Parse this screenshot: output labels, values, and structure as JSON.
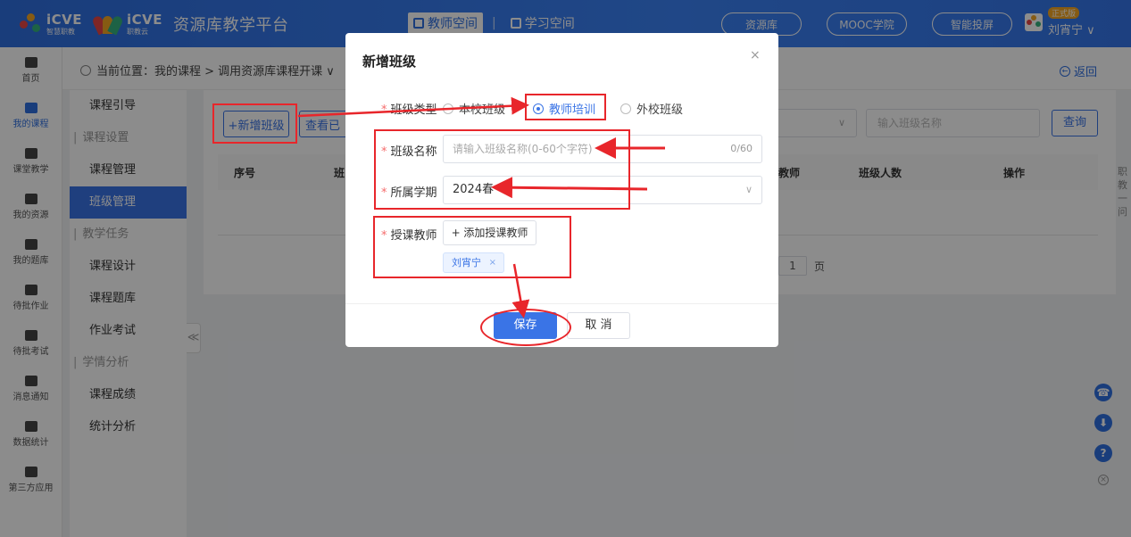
{
  "header": {
    "logo1_big": "iCVE",
    "logo1_small": "智慧职教",
    "logo2_big": "iCVE",
    "logo2_small": "职教云",
    "platform_title": "资源库教学平台",
    "tab_teacher": "教师空间",
    "tab_separator": "|",
    "tab_student": "学习空间",
    "btn_resource": "资源库",
    "btn_mooc": "MOOC学院",
    "btn_screen": "智能投屏",
    "vip_badge": "正式版",
    "user_name": "刘宵宁 ∨"
  },
  "iconnav": [
    {
      "label": "首页",
      "active": false
    },
    {
      "label": "我的课程",
      "active": true
    },
    {
      "label": "课堂教学",
      "active": false
    },
    {
      "label": "我的资源",
      "active": false
    },
    {
      "label": "我的题库",
      "active": false
    },
    {
      "label": "待批作业",
      "active": false
    },
    {
      "label": "待批考试",
      "active": false
    },
    {
      "label": "消息通知",
      "active": false
    },
    {
      "label": "数据统计",
      "active": false
    },
    {
      "label": "第三方应用",
      "active": false
    }
  ],
  "breadcrumb": {
    "text": "当前位置：我的课程 > 调用资源库课程开课 ∨",
    "back": "返回"
  },
  "submenu": {
    "item_guide": "课程引导",
    "group_setting": "课程设置",
    "item_course_mgmt": "课程管理",
    "item_class_mgmt": "班级管理",
    "group_task": "教学任务",
    "item_design": "课程设计",
    "item_bank": "课程题库",
    "item_exam": "作业考试",
    "group_analysis": "学情分析",
    "item_score": "课程成绩",
    "item_stats": "统计分析",
    "collapse": "≪"
  },
  "main": {
    "btn_new": "+新增班级",
    "btn_view": "查看已",
    "search_placeholder": "输入班级名称",
    "btn_query": "查询",
    "col_no": "序号",
    "col_class": "班",
    "col_teacher": "教师",
    "col_count": "班级人数",
    "col_action": "操作",
    "page_num": "1",
    "page_unit": "页"
  },
  "side_text": "职教一问",
  "float_icons": {
    "support": "☎",
    "download": "⬇",
    "help": "?",
    "close": "×"
  },
  "dialog": {
    "title": "新增班级",
    "close": "×",
    "label_type": "班级类型",
    "radio_school": "本校班级",
    "radio_teacher": "教师培训",
    "radio_external": "外校班级",
    "selected_type": "教师培训",
    "label_name": "班级名称",
    "name_placeholder": "请输入班级名称(0-60个字符)",
    "name_count": "0/60",
    "label_term": "所属学期",
    "term_value": "2024春",
    "label_teacher": "授课教师",
    "btn_add_teacher": "+ 添加授课教师",
    "teacher_tag": "刘宵宁",
    "tag_close": "×",
    "btn_save": "保存",
    "btn_cancel": "取 消"
  },
  "colors": {
    "primary": "#3a74e6",
    "header": "#2f6fe0",
    "annotation": "#e8262b"
  }
}
